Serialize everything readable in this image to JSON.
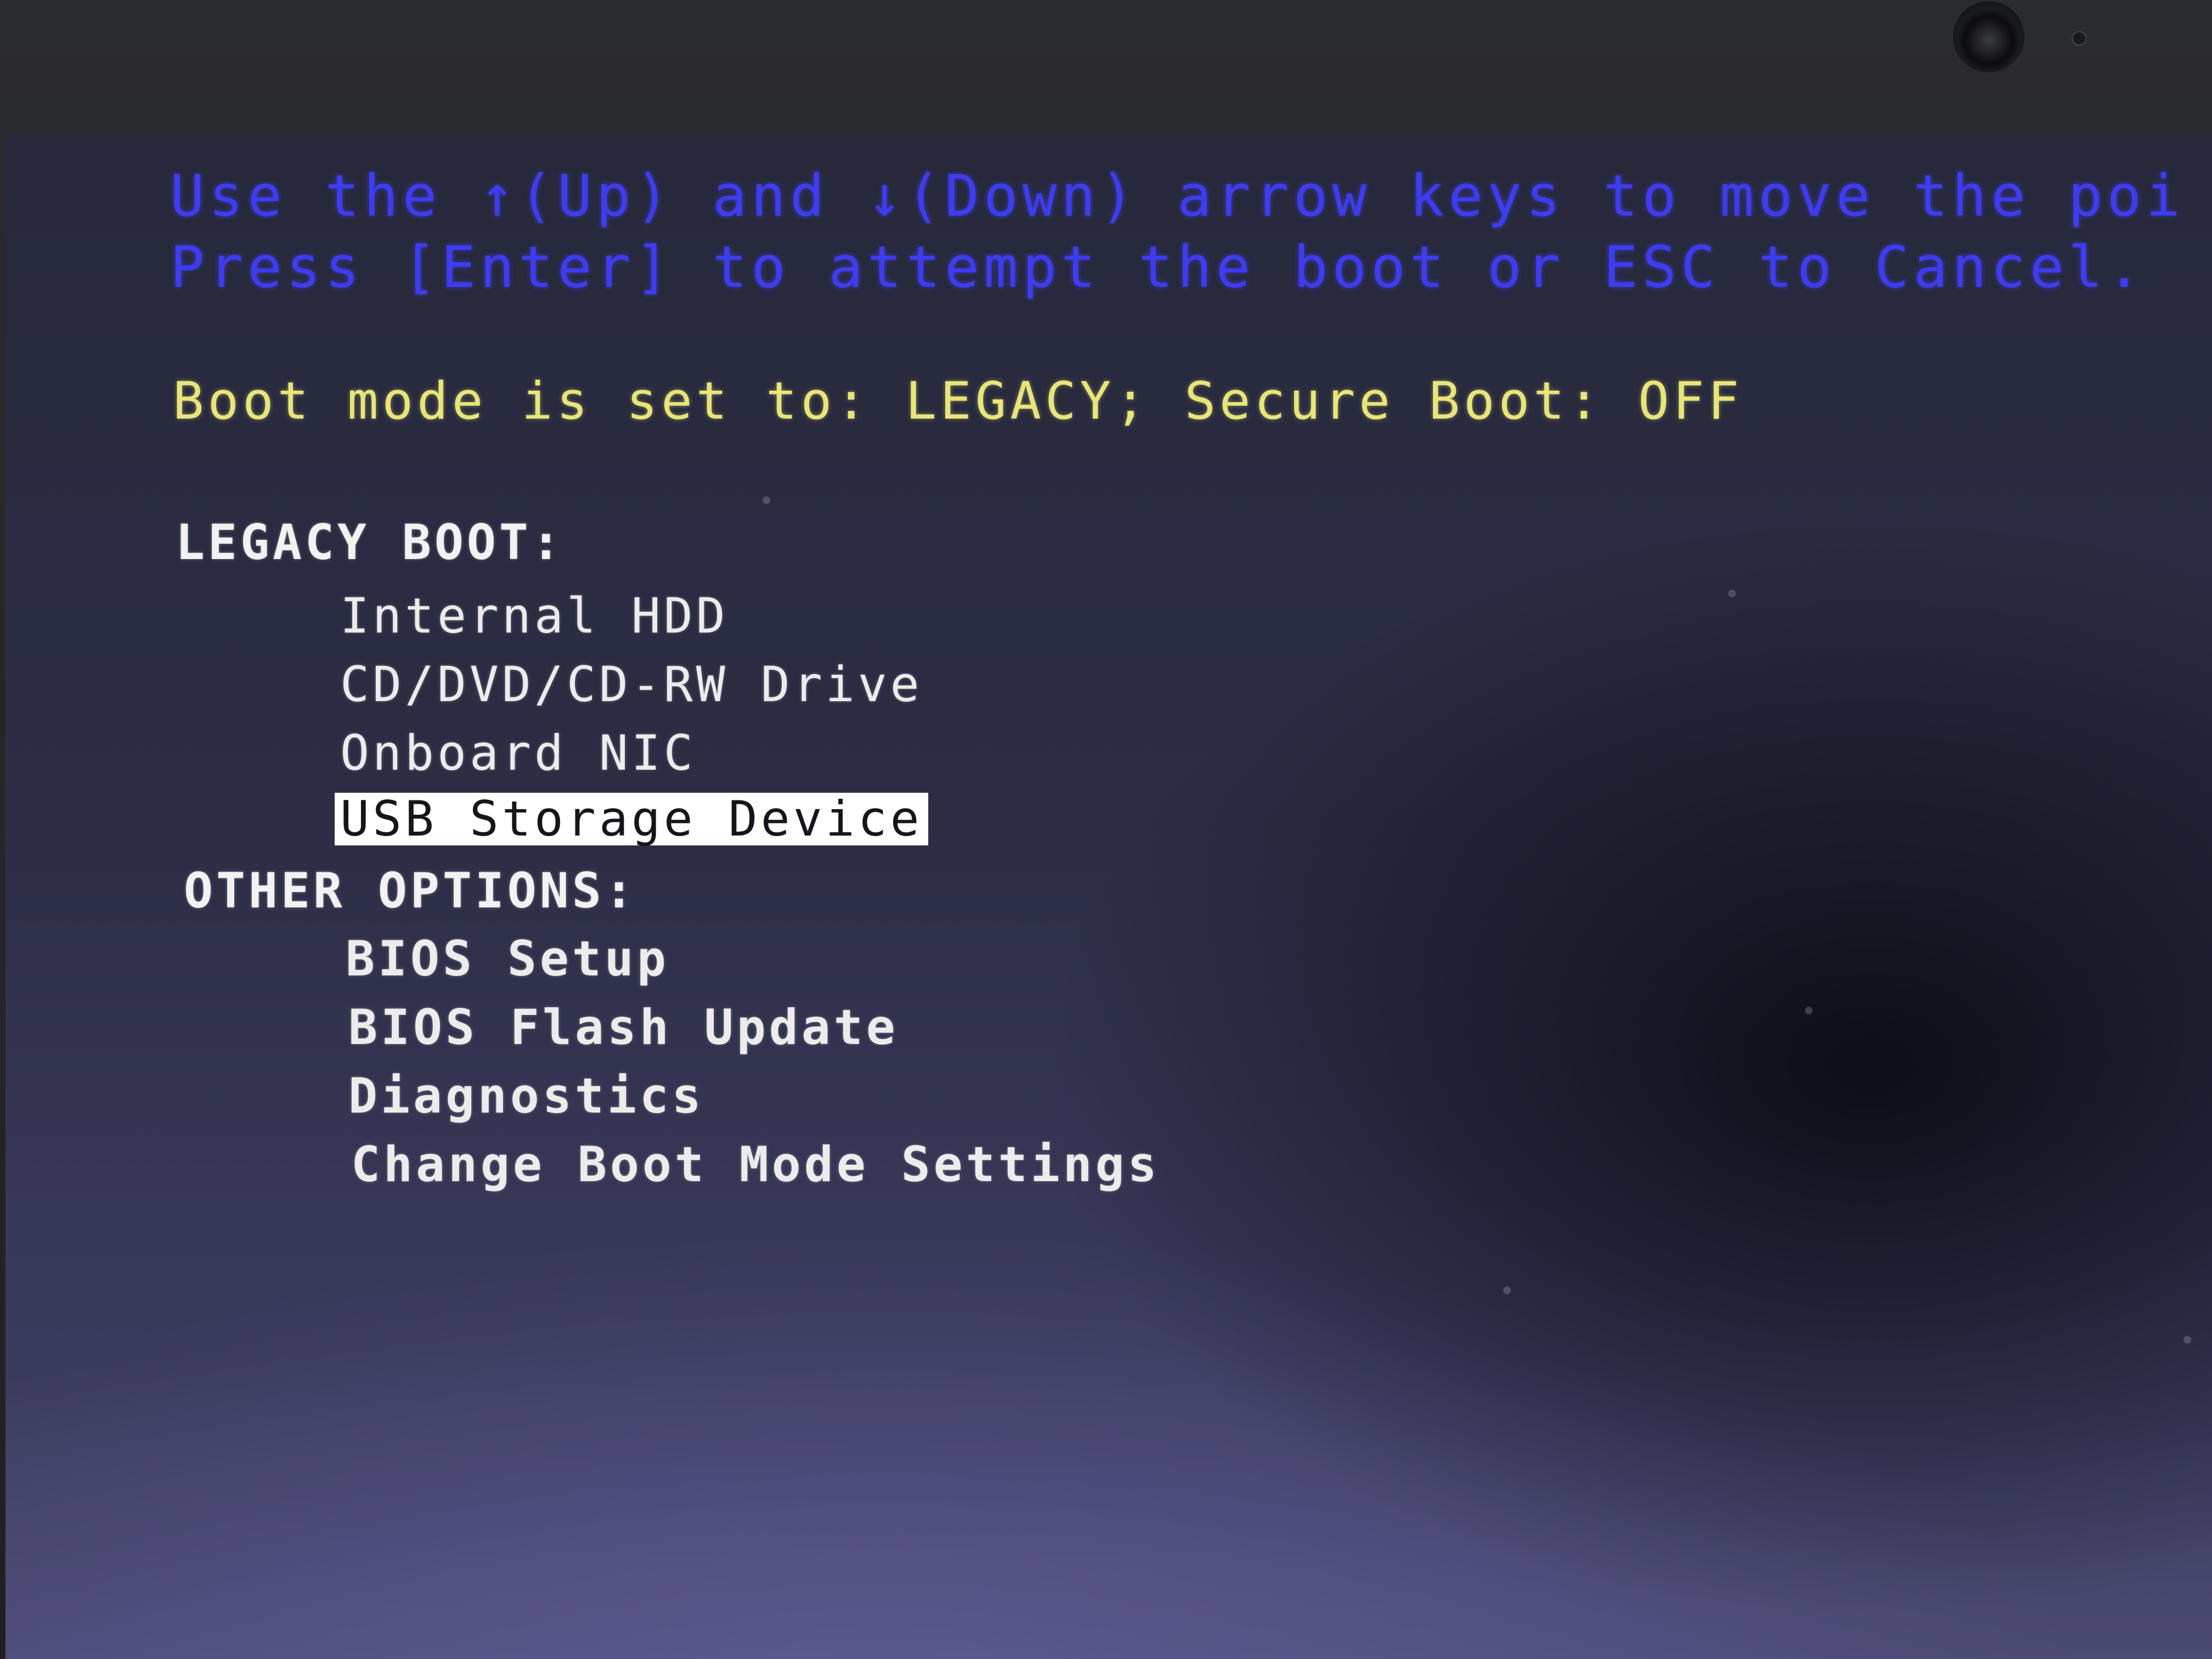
{
  "help": {
    "line1": "Use the ↑(Up) and ↓(Down) arrow keys to move the poi",
    "line2": "Press [Enter] to attempt the boot or ESC to Cancel."
  },
  "boot_mode": "Boot mode is set to: LEGACY; Secure Boot: OFF",
  "legacy": {
    "heading": "LEGACY BOOT:",
    "items": [
      {
        "label": "Internal HDD"
      },
      {
        "label": "CD/DVD/CD-RW Drive"
      },
      {
        "label": "Onboard NIC"
      },
      {
        "label": "USB Storage Device",
        "selected": true
      }
    ]
  },
  "other": {
    "heading": "OTHER OPTIONS:",
    "items": [
      {
        "label": "BIOS Setup"
      },
      {
        "label": "BIOS Flash Update"
      },
      {
        "label": "Diagnostics"
      },
      {
        "label": "Change Boot Mode Settings"
      }
    ]
  },
  "colors": {
    "help_text": "#3d3cf0",
    "boot_mode_text": "#e8e57a",
    "menu_text": "#ececec",
    "selection_bg": "#ffffff",
    "selection_text": "#15151c"
  }
}
